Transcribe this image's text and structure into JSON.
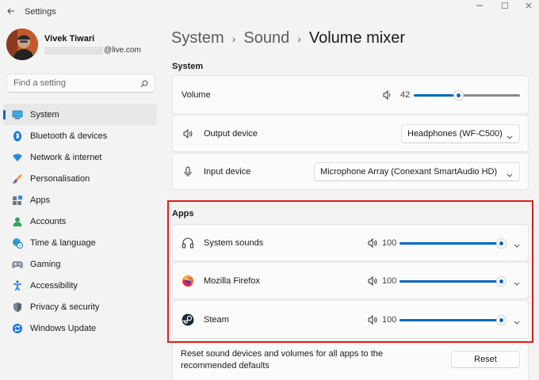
{
  "window": {
    "title": "Settings",
    "back_icon": "back-arrow-icon",
    "controls": [
      "minimize-icon",
      "maximize-icon",
      "close-icon"
    ]
  },
  "profile": {
    "name": "Vivek Tiwari",
    "email_suffix": "@live.com"
  },
  "search": {
    "placeholder": "Find a setting"
  },
  "sidebar": {
    "items": [
      {
        "label": "System",
        "icon": "system-icon",
        "active": true
      },
      {
        "label": "Bluetooth & devices",
        "icon": "bluetooth-icon"
      },
      {
        "label": "Network & internet",
        "icon": "network-icon"
      },
      {
        "label": "Personalisation",
        "icon": "brush-icon"
      },
      {
        "label": "Apps",
        "icon": "apps-icon"
      },
      {
        "label": "Accounts",
        "icon": "accounts-icon"
      },
      {
        "label": "Time & language",
        "icon": "globe-clock-icon"
      },
      {
        "label": "Gaming",
        "icon": "gamepad-icon"
      },
      {
        "label": "Accessibility",
        "icon": "accessibility-icon"
      },
      {
        "label": "Privacy & security",
        "icon": "shield-icon"
      },
      {
        "label": "Windows Update",
        "icon": "update-icon"
      }
    ]
  },
  "breadcrumb": {
    "items": [
      "System",
      "Sound",
      "Volume mixer"
    ],
    "separator": "›"
  },
  "system_section": {
    "title": "System",
    "volume": {
      "label": "Volume",
      "value": "42",
      "level": 0.42
    },
    "output": {
      "label": "Output device",
      "selected": "Headphones (WF-C500)"
    },
    "input": {
      "label": "Input device",
      "selected": "Microphone Array (Conexant SmartAudio HD)"
    }
  },
  "apps_section": {
    "title": "Apps",
    "apps": [
      {
        "name": "System sounds",
        "icon": "headphones-icon",
        "volume": "100",
        "level": 1.0
      },
      {
        "name": "Mozilla Firefox",
        "icon": "firefox-icon",
        "volume": "100",
        "level": 1.0
      },
      {
        "name": "Steam",
        "icon": "steam-icon",
        "volume": "100",
        "level": 1.0
      }
    ]
  },
  "reset": {
    "text": "Reset sound devices and volumes for all apps to the recommended defaults",
    "button": "Reset"
  },
  "colors": {
    "accent": "#0067c0",
    "highlight_border": "#e11a1a",
    "background": "#f3f3f3"
  }
}
